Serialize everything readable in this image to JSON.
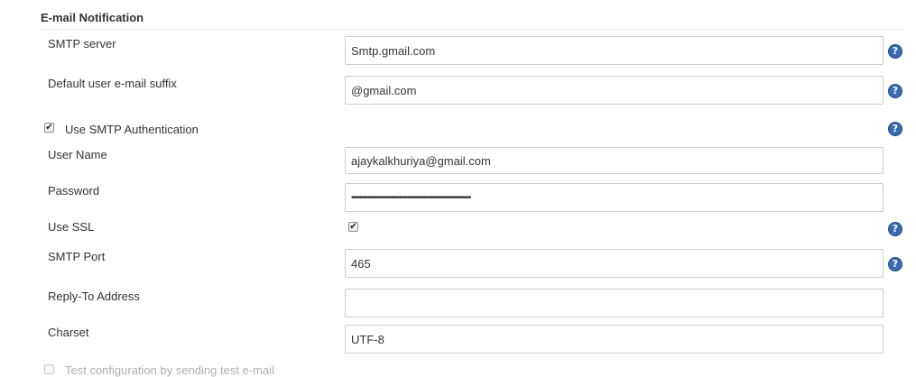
{
  "section": {
    "title": "E-mail Notification"
  },
  "fields": {
    "smtp_server": {
      "label": "SMTP server",
      "value": "Smtp.gmail.com"
    },
    "email_suffix": {
      "label": "Default user e-mail suffix",
      "value": "@gmail.com"
    },
    "use_smtp_auth": {
      "label": "Use SMTP Authentication",
      "checked": true
    },
    "user_name": {
      "label": "User Name",
      "value": "ajaykalkhuriya@gmail.com"
    },
    "password": {
      "label": "Password",
      "value": "••••••••••••••••••••••••••••••••••••••••••••••••••••••••••••"
    },
    "use_ssl": {
      "label": "Use SSL",
      "checked": true
    },
    "smtp_port": {
      "label": "SMTP Port",
      "value": "465"
    },
    "reply_to": {
      "label": "Reply-To Address",
      "value": ""
    },
    "charset": {
      "label": "Charset",
      "value": "UTF-8"
    },
    "test_config": {
      "label": "Test configuration by sending test e-mail",
      "checked": false
    }
  },
  "icons": {
    "help": "help-icon",
    "check": "checkmark-icon"
  },
  "glyphs": {
    "help": "?",
    "check": "✔"
  },
  "colors": {
    "help_bg": "#3a6bb0",
    "field_border": "#cccccc",
    "text": "#333333"
  }
}
